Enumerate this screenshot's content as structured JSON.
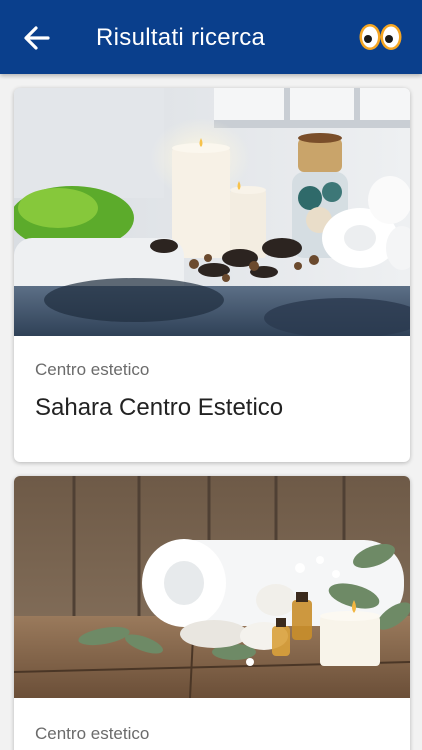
{
  "header": {
    "title": "Risultati ricerca",
    "back_icon": "arrow-left-icon",
    "logo_icon": "eyes-logo-icon",
    "background": "#0a3f8c"
  },
  "results": [
    {
      "category": "Centro estetico",
      "name": "Sahara Centro Estetico",
      "photo": "spa-candles-stones-towels"
    },
    {
      "category": "Centro estetico",
      "name": "",
      "photo": "spa-rolled-towel-oils-candle"
    }
  ]
}
